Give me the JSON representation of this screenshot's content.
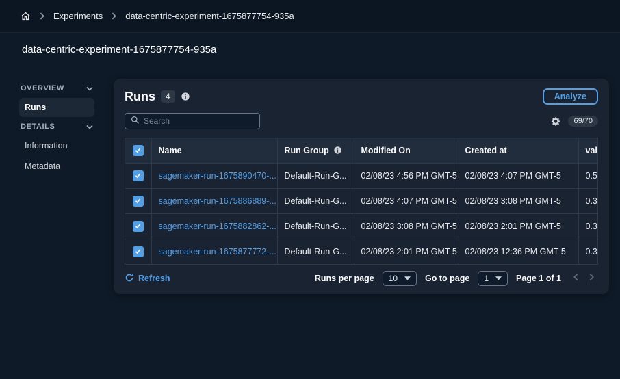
{
  "colors": {
    "accent": "#539fe5",
    "background": "#0e1a27",
    "card": "#1a2332"
  },
  "breadcrumb": {
    "experiments": "Experiments",
    "current": "data-centric-experiment-1675877754-935a"
  },
  "page": {
    "title": "data-centric-experiment-1675877754-935a"
  },
  "sidebar": {
    "overview": "OVERVIEW",
    "runs": "Runs",
    "details": "DETAILS",
    "information": "Information",
    "metadata": "Metadata"
  },
  "runs_panel": {
    "title": "Runs",
    "count": "4",
    "analyze": "Analyze",
    "search_placeholder": "Search",
    "counter": "69/70",
    "table": {
      "headers": {
        "name": "Name",
        "run_group": "Run Group",
        "modified_on": "Modified On",
        "created_at": "Created at",
        "val": "val"
      },
      "rows": [
        {
          "name": "sagemaker-run-1675890470-...",
          "run_group": "Default-Run-G...",
          "modified_on": "02/08/23 4:56 PM GMT-5",
          "created_at": "02/08/23 4:07 PM GMT-5",
          "val": "0.5"
        },
        {
          "name": "sagemaker-run-1675886889-...",
          "run_group": "Default-Run-G...",
          "modified_on": "02/08/23 4:07 PM GMT-5",
          "created_at": "02/08/23 3:08 PM GMT-5",
          "val": "0.3"
        },
        {
          "name": "sagemaker-run-1675882862-...",
          "run_group": "Default-Run-G...",
          "modified_on": "02/08/23 3:08 PM GMT-5",
          "created_at": "02/08/23 2:01 PM GMT-5",
          "val": "0.3"
        },
        {
          "name": "sagemaker-run-1675877772-...",
          "run_group": "Default-Run-G...",
          "modified_on": "02/08/23 2:01 PM GMT-5",
          "created_at": "02/08/23 12:36 PM GMT-5",
          "val": "0.3"
        }
      ]
    },
    "footer": {
      "refresh": "Refresh",
      "runs_per_page_label": "Runs per page",
      "runs_per_page_value": "10",
      "goto_label": "Go to page",
      "goto_value": "1",
      "page_info": "Page 1 of 1"
    }
  }
}
